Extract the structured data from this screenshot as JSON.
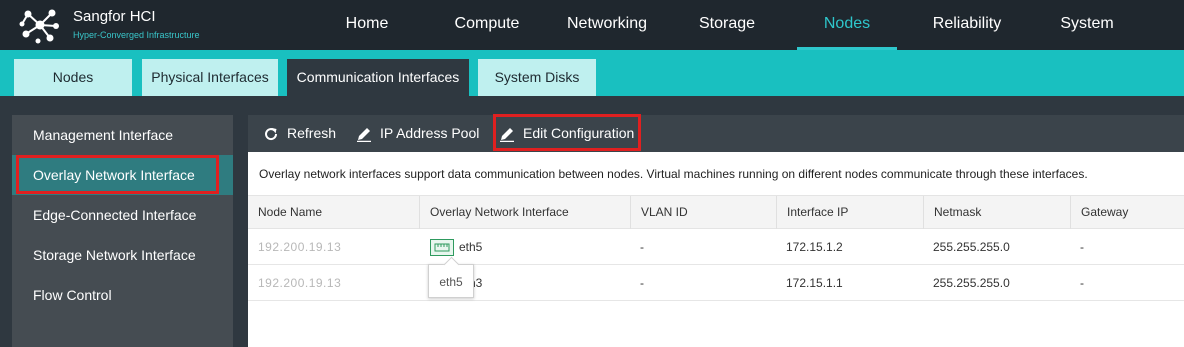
{
  "brand": {
    "title": "Sangfor HCI",
    "subtitle": "Hyper-Converged Infrastructure"
  },
  "nav": {
    "items": [
      "Home",
      "Compute",
      "Networking",
      "Storage",
      "Nodes",
      "Reliability",
      "System"
    ],
    "active": "Nodes"
  },
  "subtabs": {
    "items": [
      "Nodes",
      "Physical Interfaces",
      "Communication Interfaces",
      "System Disks"
    ],
    "active": "Communication Interfaces"
  },
  "sidebar": {
    "items": [
      "Management Interface",
      "Overlay Network Interface",
      "Edge-Connected Interface",
      "Storage Network Interface",
      "Flow Control"
    ],
    "active": "Overlay Network Interface"
  },
  "toolbar": {
    "refresh": "Refresh",
    "ip_pool": "IP Address Pool",
    "edit_config": "Edit Configuration"
  },
  "notice": "Overlay network interfaces support data communication between nodes. Virtual machines running on different nodes communicate through these interfaces.",
  "table": {
    "headers": [
      "Node Name",
      "Overlay Network Interface",
      "VLAN ID",
      "Interface IP",
      "Netmask",
      "Gateway"
    ],
    "rows": [
      {
        "node": "192.200.19.13",
        "iface": "eth5",
        "vlan": "-",
        "ip": "172.15.1.2",
        "mask": "255.255.255.0",
        "gw": "-"
      },
      {
        "node": "192.200.19.13",
        "iface": "eth3",
        "vlan": "-",
        "ip": "172.15.1.1",
        "mask": "255.255.255.0",
        "gw": "-"
      }
    ]
  },
  "tooltip": "eth5",
  "colors": {
    "accent": "#2ec7cc",
    "highlight": "#e02020",
    "subbar": "#19c0c0"
  }
}
